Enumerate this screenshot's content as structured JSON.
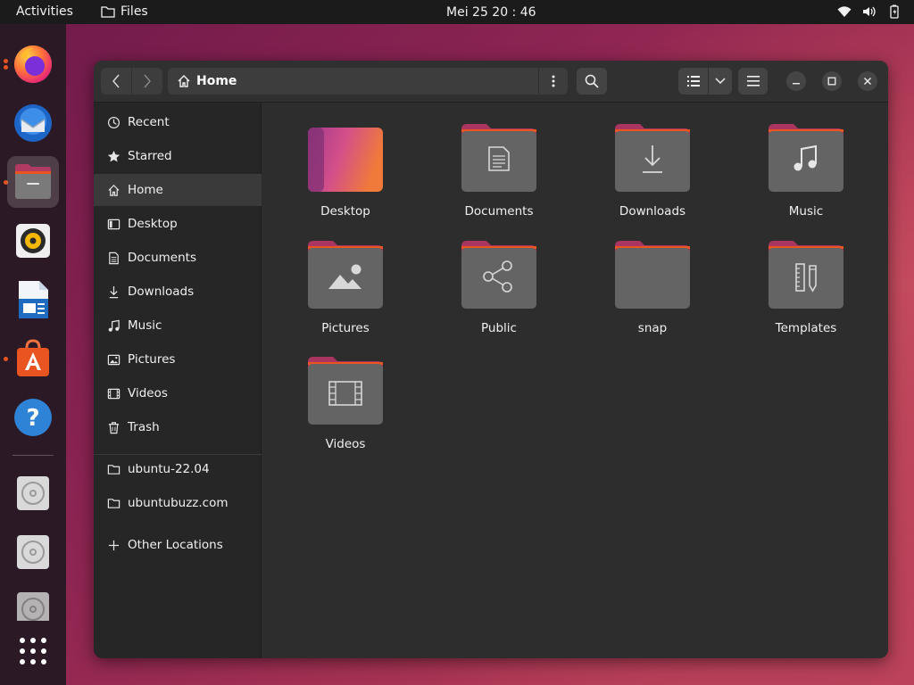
{
  "topbar": {
    "activities": "Activities",
    "app_name": "Files",
    "clock": "Mei 25  20 : 46"
  },
  "dock": {
    "apps": [
      "firefox-icon",
      "thunderbird-icon",
      "files-icon",
      "rhythmbox-icon",
      "writer-icon",
      "software-icon",
      "help-icon",
      "disc-icon",
      "disc-icon",
      "disc-icon",
      "app-grid-icon"
    ]
  },
  "headerbar": {
    "path_home": "Home"
  },
  "sidebar": {
    "items": [
      {
        "label": "Recent",
        "icon": "clock-icon"
      },
      {
        "label": "Starred",
        "icon": "star-icon"
      },
      {
        "label": "Home",
        "icon": "home-icon"
      },
      {
        "label": "Desktop",
        "icon": "desktop-icon"
      },
      {
        "label": "Documents",
        "icon": "document-icon"
      },
      {
        "label": "Downloads",
        "icon": "download-icon"
      },
      {
        "label": "Music",
        "icon": "music-icon"
      },
      {
        "label": "Pictures",
        "icon": "picture-icon"
      },
      {
        "label": "Videos",
        "icon": "video-icon"
      },
      {
        "label": "Trash",
        "icon": "trash-icon"
      }
    ],
    "bookmarks": [
      {
        "label": "ubuntu-22.04",
        "icon": "folder-icon"
      },
      {
        "label": "ubuntubuzz.com",
        "icon": "folder-icon"
      }
    ],
    "other_locations": "Other Locations"
  },
  "folders": [
    {
      "label": "Desktop",
      "icon": "desktop-folder-icon"
    },
    {
      "label": "Documents",
      "icon": "document-folder-icon"
    },
    {
      "label": "Downloads",
      "icon": "download-folder-icon"
    },
    {
      "label": "Music",
      "icon": "music-folder-icon"
    },
    {
      "label": "Pictures",
      "icon": "picture-folder-icon"
    },
    {
      "label": "Public",
      "icon": "share-folder-icon"
    },
    {
      "label": "snap",
      "icon": "folder-icon"
    },
    {
      "label": "Templates",
      "icon": "template-folder-icon"
    },
    {
      "label": "Videos",
      "icon": "video-folder-icon"
    }
  ],
  "colors": {
    "accent": "#e95420",
    "folder_tab": "#a93560",
    "folder_body": "#646464"
  }
}
